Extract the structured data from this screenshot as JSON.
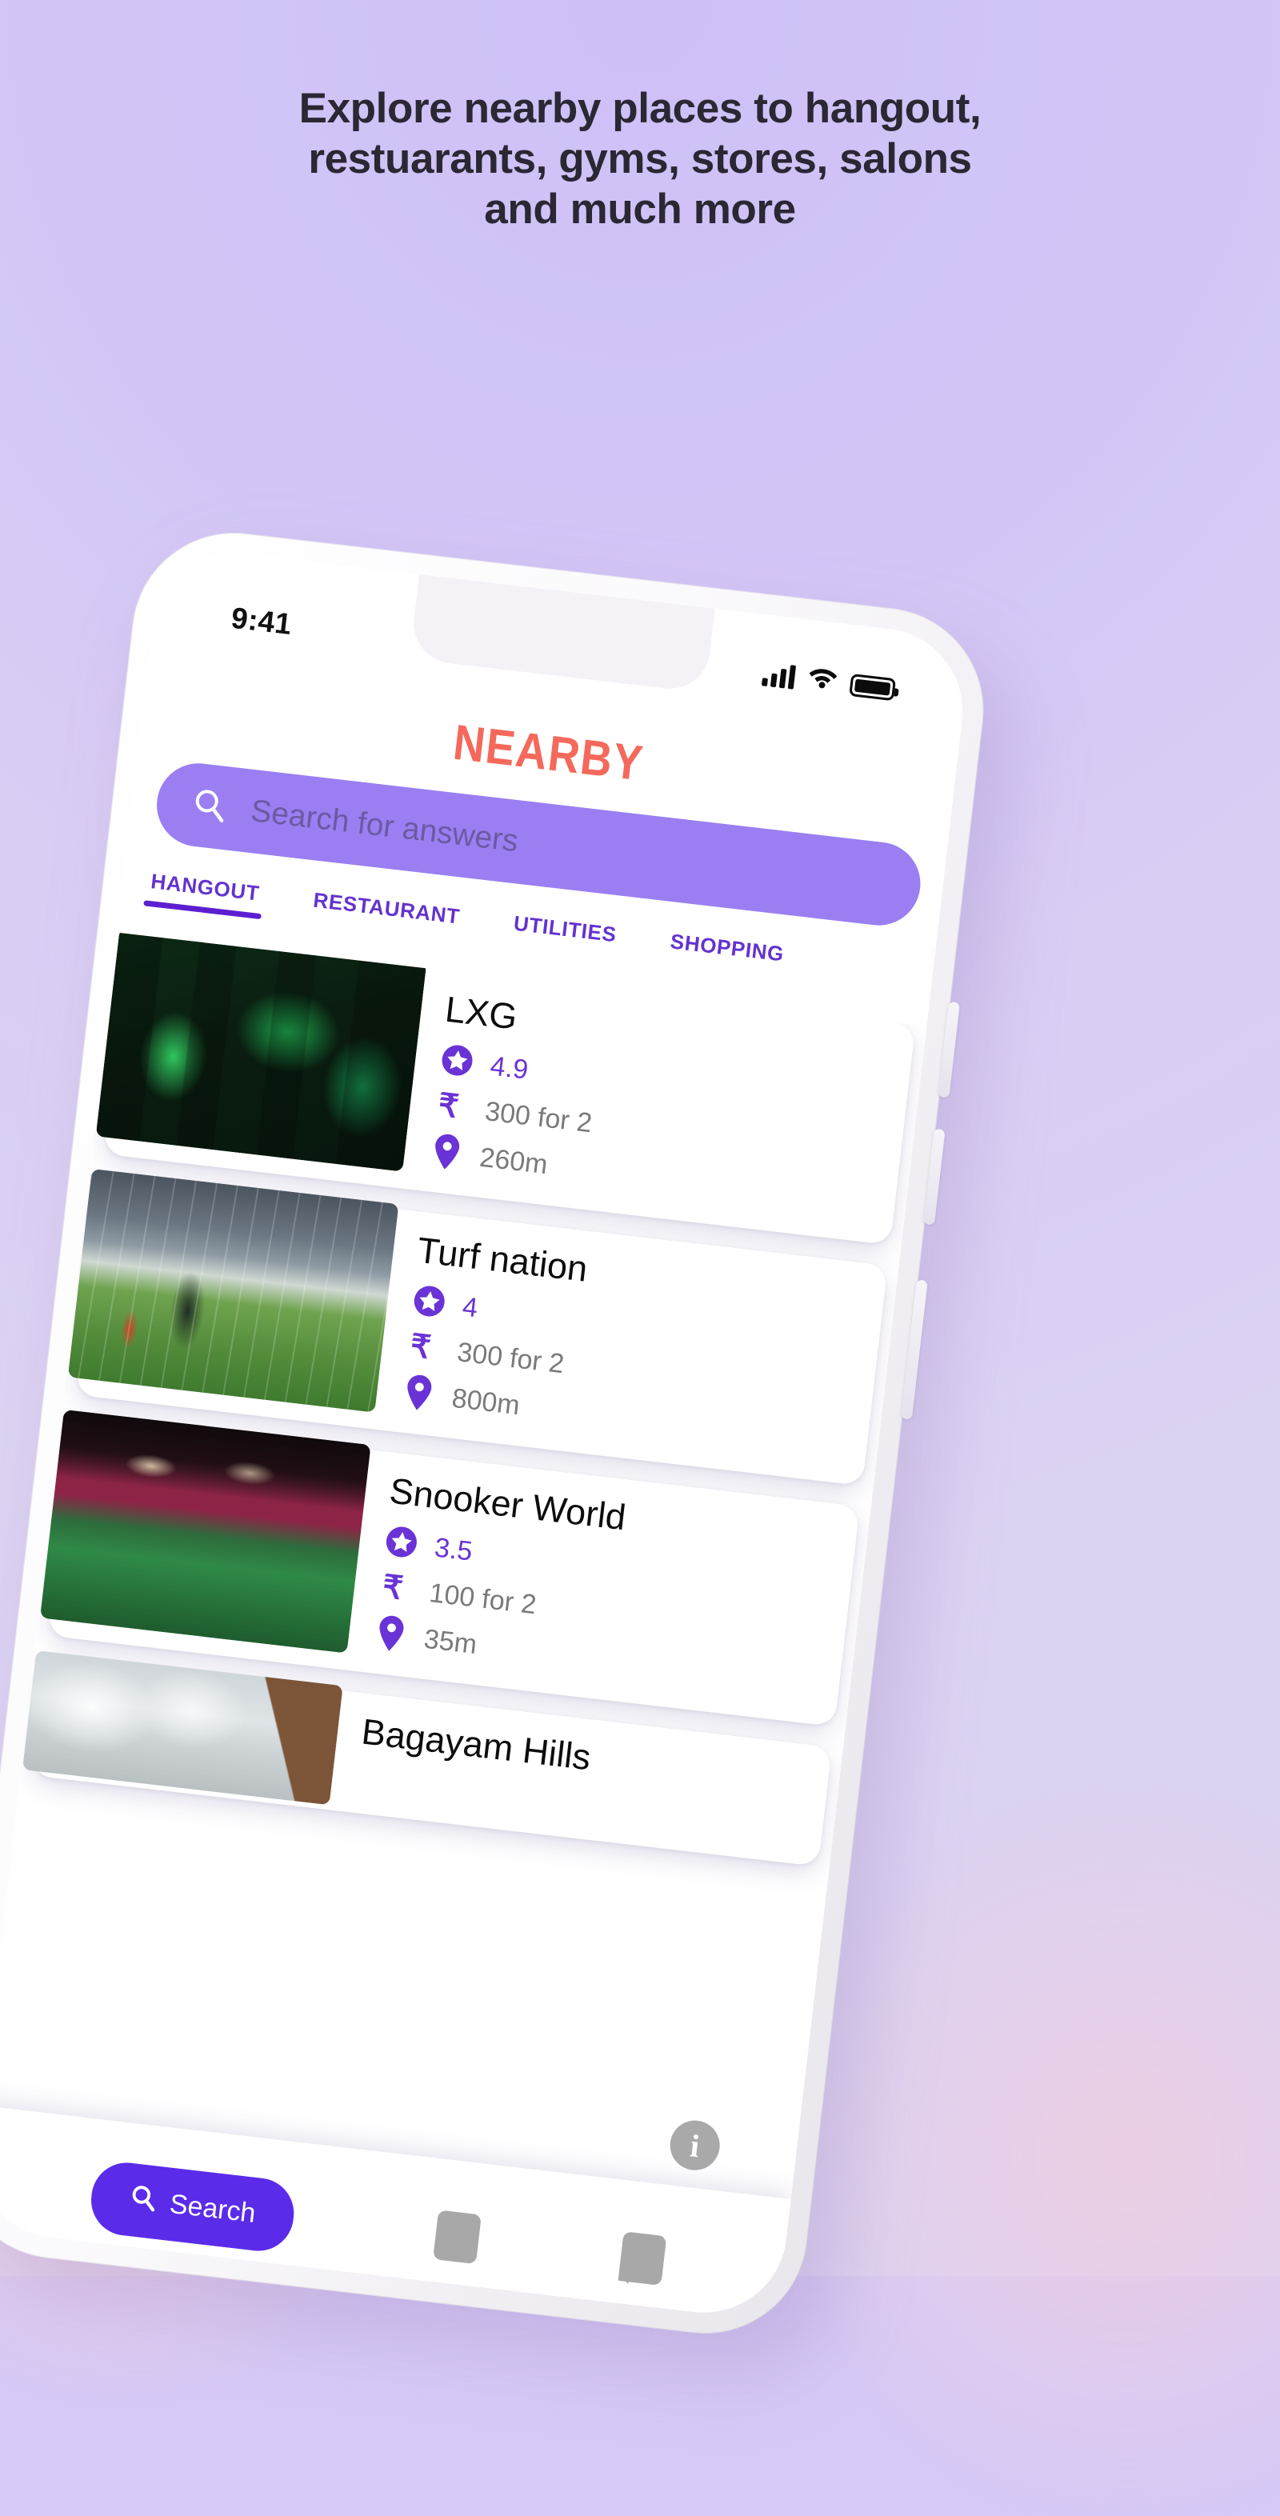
{
  "page": {
    "headline_lines": [
      "Explore nearby places to hangout,",
      "restuarants, gyms, stores, salons",
      "and much more"
    ]
  },
  "colors": {
    "background": "#d6c9f5",
    "brand": "#f4695b",
    "accent_purple": "#5b2bea",
    "search_bar": "#9b7ef2",
    "tab_text": "#6333cf",
    "meta_text": "#7a7a7a"
  },
  "phone": {
    "status_bar": {
      "time": "9:41",
      "icons": [
        "signal-icon",
        "wifi-icon",
        "battery-icon"
      ]
    },
    "brand": "NEARBY",
    "search": {
      "icon": "search-icon",
      "placeholder": "Search for answers",
      "value": ""
    },
    "tabs": [
      {
        "label": "HANGOUT",
        "active": true
      },
      {
        "label": "RESTAURANT",
        "active": false
      },
      {
        "label": "UTILITIES",
        "active": false
      },
      {
        "label": "SHOPPING",
        "active": false
      }
    ],
    "places": [
      {
        "name": "LXG",
        "rating": "4.9",
        "price": "300 for 2",
        "distance": "260m",
        "photo": "gaming-cafe-photo"
      },
      {
        "name": "Turf nation",
        "rating": "4",
        "price": "300 for 2",
        "distance": "800m",
        "photo": "turf-ground-photo"
      },
      {
        "name": "Snooker World",
        "rating": "3.5",
        "price": "100 for 2",
        "distance": "35m",
        "photo": "snooker-hall-photo"
      },
      {
        "name": "Bagayam Hills",
        "rating": "",
        "price": "",
        "distance": "",
        "photo": "hills-photo"
      }
    ],
    "meta_icons": {
      "rating": "star-badge-icon",
      "price": "rupee-icon",
      "distance": "location-pin-icon"
    },
    "bottom_nav": {
      "primary_label": "Search",
      "primary_icon": "search-icon",
      "items": [
        "bookmark-icon",
        "chat-icon"
      ]
    },
    "info_badge": "i"
  }
}
